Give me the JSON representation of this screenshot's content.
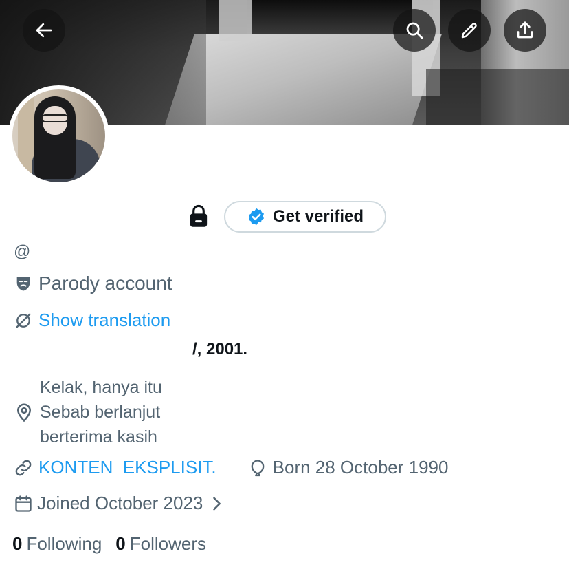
{
  "profile": {
    "badge_label": "Get verified",
    "handle_prefix": "@",
    "parody_label": "Parody account",
    "translate_label": "Show translation",
    "bio_visible": "/, 2001.",
    "location_text": "Kelak, hanya itu\nSebab berlanjut\nberterima kasih",
    "website": "KONTEN  EKSPLISIT.",
    "born": "Born 28 October 1990",
    "joined": "Joined October 2023",
    "following_count": "0",
    "following_label": "Following",
    "followers_count": "0",
    "followers_label": "Followers"
  },
  "icons": {
    "back": "arrow-left-icon",
    "search": "search-icon",
    "edit": "pencil-icon",
    "share": "share-icon",
    "lock": "lock-icon",
    "verified": "verified-badge-icon",
    "parody": "theater-mask-icon",
    "translate": "translate-icon",
    "location": "location-pin-icon",
    "link": "link-icon",
    "birthday": "balloon-icon",
    "calendar": "calendar-icon",
    "chevron": "chevron-right-icon"
  },
  "colors": {
    "accent": "#1d9bf0",
    "secondary_text": "#536471",
    "primary_text": "#0f1419"
  }
}
